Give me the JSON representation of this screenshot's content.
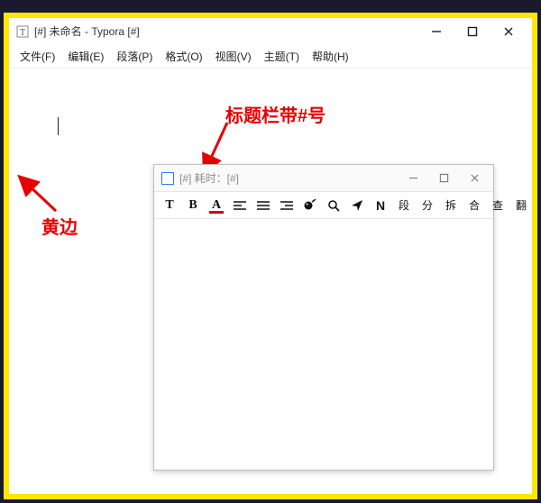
{
  "mainWindow": {
    "title": "[#] 未命名 - Typora [#]",
    "menus": [
      "文件(F)",
      "编辑(E)",
      "段落(P)",
      "格式(O)",
      "视图(V)",
      "主题(T)",
      "帮助(H)"
    ]
  },
  "annotations": {
    "titlebarHash": "标题栏带#号",
    "yellowEdge": "黄边"
  },
  "floatWindow": {
    "title": "[#] 耗时：[#]",
    "toolbar": {
      "t": "T",
      "b": "B",
      "a": "A",
      "n": "N",
      "cn1": "段",
      "cn2": "分",
      "cn3": "拆",
      "cn4": "合",
      "cn5": "查",
      "cn6": "翻"
    }
  }
}
